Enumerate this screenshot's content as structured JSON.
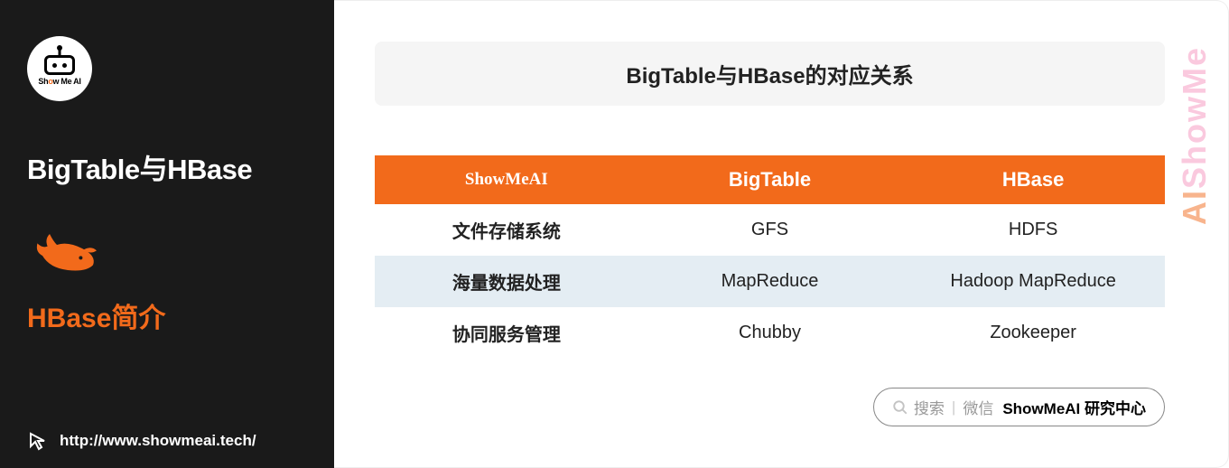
{
  "sidebar": {
    "logo_text_prefix": "Sh",
    "logo_text_o": "o",
    "logo_text_suffix": "w Me AI",
    "title": "BigTable与HBase",
    "subtitle": "HBase简介",
    "url": "http://www.showmeai.tech/"
  },
  "main": {
    "header": "BigTable与HBase的对应关系",
    "watermark_top": "ShowMe",
    "watermark_bottom": "AI"
  },
  "table": {
    "headers": [
      "ShowMeAI",
      "BigTable",
      "HBase"
    ],
    "rows": [
      [
        "文件存储系统",
        "GFS",
        "HDFS"
      ],
      [
        "海量数据处理",
        "MapReduce",
        "Hadoop MapReduce"
      ],
      [
        "协同服务管理",
        "Chubby",
        "Zookeeper"
      ]
    ]
  },
  "search": {
    "label1": "搜索",
    "label2": "微信",
    "bold": "ShowMeAI 研究中心"
  },
  "chart_data": {
    "type": "table",
    "title": "BigTable与HBase的对应关系",
    "columns": [
      "ShowMeAI",
      "BigTable",
      "HBase"
    ],
    "rows": [
      {
        "ShowMeAI": "文件存储系统",
        "BigTable": "GFS",
        "HBase": "HDFS"
      },
      {
        "ShowMeAI": "海量数据处理",
        "BigTable": "MapReduce",
        "HBase": "Hadoop MapReduce"
      },
      {
        "ShowMeAI": "协同服务管理",
        "BigTable": "Chubby",
        "HBase": "Zookeeper"
      }
    ]
  }
}
